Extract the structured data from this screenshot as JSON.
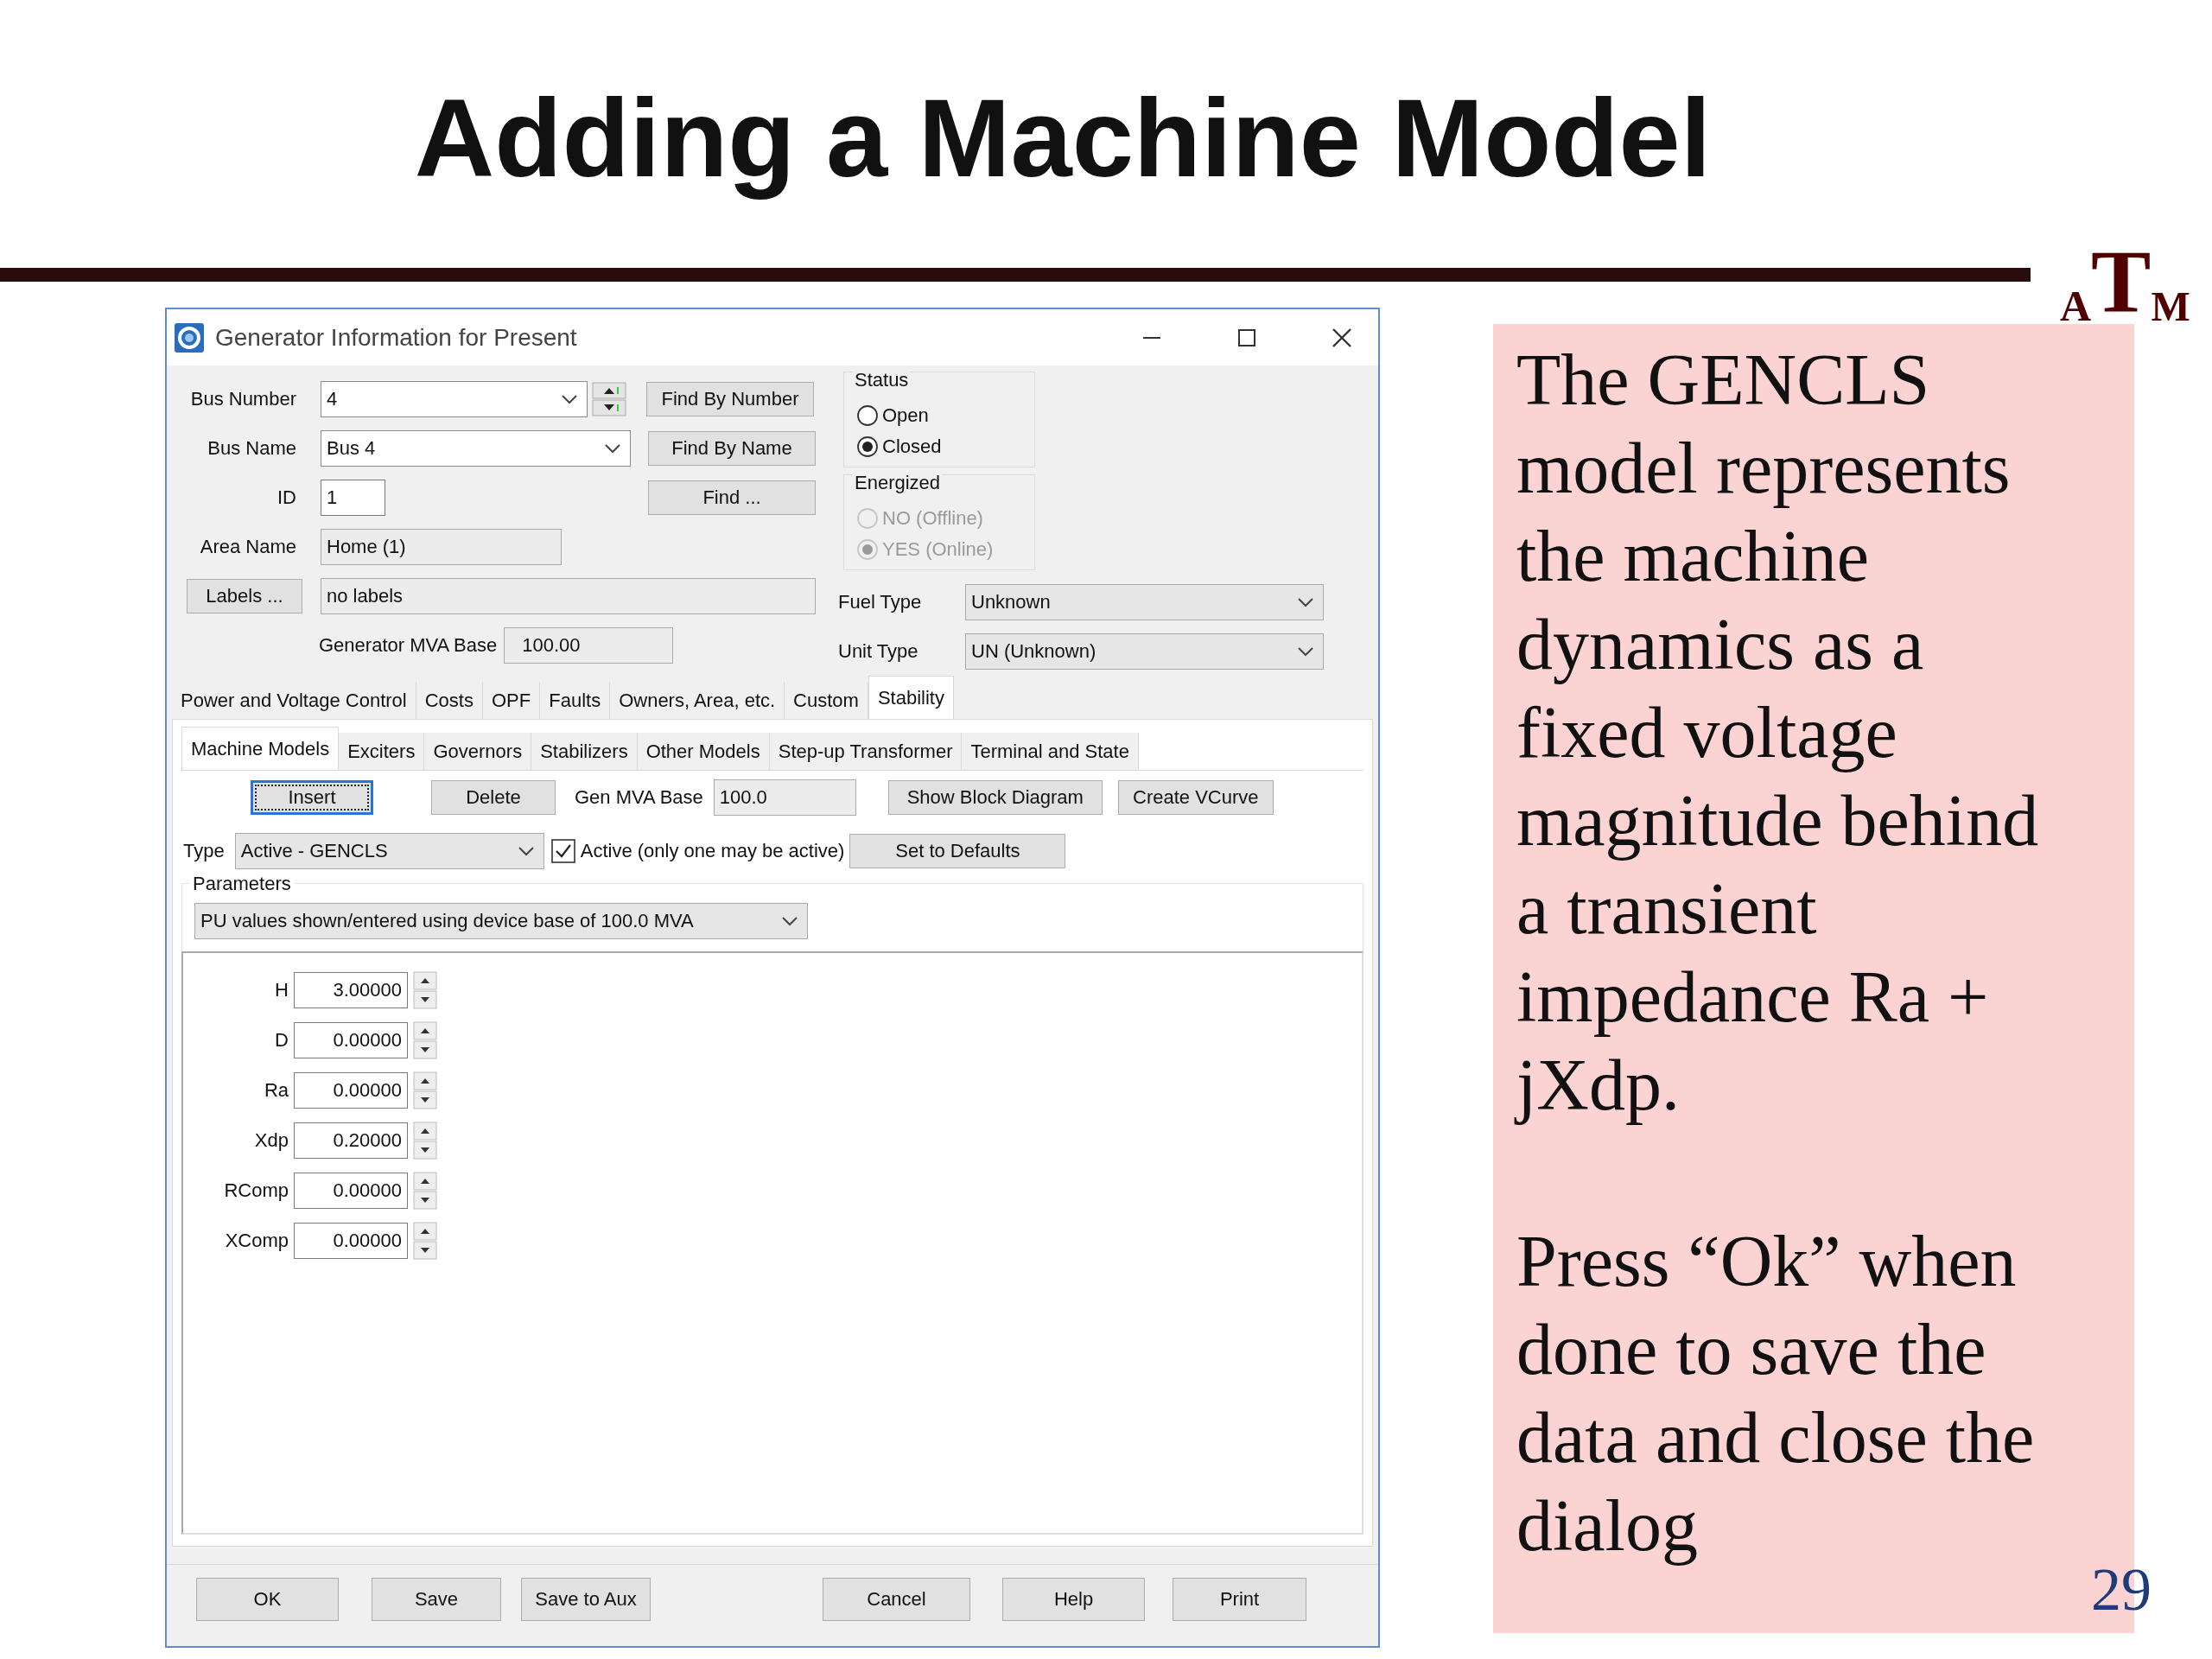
{
  "slide": {
    "title": "Adding a Machine Model",
    "logo": {
      "letters": [
        "A",
        "T",
        "M"
      ]
    },
    "page_number": "29",
    "note": {
      "paragraphs": [
        "The GENCLS model represents the machine dynamics as a fixed voltage magnitude behind a transient impedance Ra + jXdp.",
        "Press “Ok” when done to save the data and close the dialog"
      ]
    }
  },
  "window": {
    "title": "Generator Information for Present",
    "bus_number": {
      "label": "Bus Number",
      "value": "4"
    },
    "bus_name": {
      "label": "Bus Name",
      "value": "Bus 4"
    },
    "id": {
      "label": "ID",
      "value": "1"
    },
    "area_name": {
      "label": "Area Name",
      "value": "Home (1)",
      "readonly": true
    },
    "labels": {
      "button": "Labels ...",
      "value": "no labels",
      "readonly": true
    },
    "mva_base": {
      "label": "Generator MVA Base",
      "value": "100.00",
      "readonly": true
    },
    "find_buttons": [
      "Find By Number",
      "Find By Name",
      "Find ..."
    ],
    "status": {
      "title": "Status",
      "disabled": false,
      "options": [
        {
          "label": "Open",
          "selected": false
        },
        {
          "label": "Closed",
          "selected": true
        }
      ]
    },
    "energized": {
      "title": "Energized",
      "disabled": true,
      "options": [
        {
          "label": "NO (Offline)",
          "selected": false
        },
        {
          "label": "YES (Online)",
          "selected": true
        }
      ]
    },
    "fuel_type": {
      "label": "Fuel Type",
      "value": "Unknown"
    },
    "unit_type": {
      "label": "Unit Type",
      "value": "UN (Unknown)"
    },
    "tabs": [
      {
        "label": "Power and Voltage Control",
        "selected": false
      },
      {
        "label": "Costs",
        "selected": false
      },
      {
        "label": "OPF",
        "selected": false
      },
      {
        "label": "Faults",
        "selected": false
      },
      {
        "label": "Owners, Area, etc.",
        "selected": false
      },
      {
        "label": "Custom",
        "selected": false
      },
      {
        "label": "Stability",
        "selected": true
      }
    ],
    "subtabs": [
      {
        "label": "Machine Models",
        "selected": true
      },
      {
        "label": "Exciters",
        "selected": false
      },
      {
        "label": "Governors",
        "selected": false
      },
      {
        "label": "Stabilizers",
        "selected": false
      },
      {
        "label": "Other Models",
        "selected": false
      },
      {
        "label": "Step-up Transformer",
        "selected": false
      },
      {
        "label": "Terminal and State",
        "selected": false
      }
    ],
    "insert_button": {
      "label": "Insert",
      "focused": true
    },
    "delete_button": "Delete",
    "gen_mva_base": {
      "label": "Gen MVA Base",
      "value": "100.0",
      "readonly": true
    },
    "show_block_diagram": "Show Block Diagram",
    "create_vcurve": "Create VCurve",
    "type": {
      "label": "Type",
      "value": "Active - GENCLS"
    },
    "active": {
      "label": "Active (only one may be active)",
      "checked": true
    },
    "set_defaults": "Set to Defaults",
    "parameters": {
      "title": "Parameters",
      "units": "PU values shown/entered using device base of 100.0 MVA",
      "rows": [
        {
          "label": "H",
          "value": "3.00000"
        },
        {
          "label": "D",
          "value": "0.00000"
        },
        {
          "label": "Ra",
          "value": "0.00000"
        },
        {
          "label": "Xdp",
          "value": "0.20000"
        },
        {
          "label": "RComp",
          "value": "0.00000"
        },
        {
          "label": "XComp",
          "value": "0.00000"
        }
      ]
    },
    "footer_buttons": [
      "OK",
      "Save",
      "Save to Aux",
      "Cancel",
      "Help",
      "Print"
    ]
  }
}
